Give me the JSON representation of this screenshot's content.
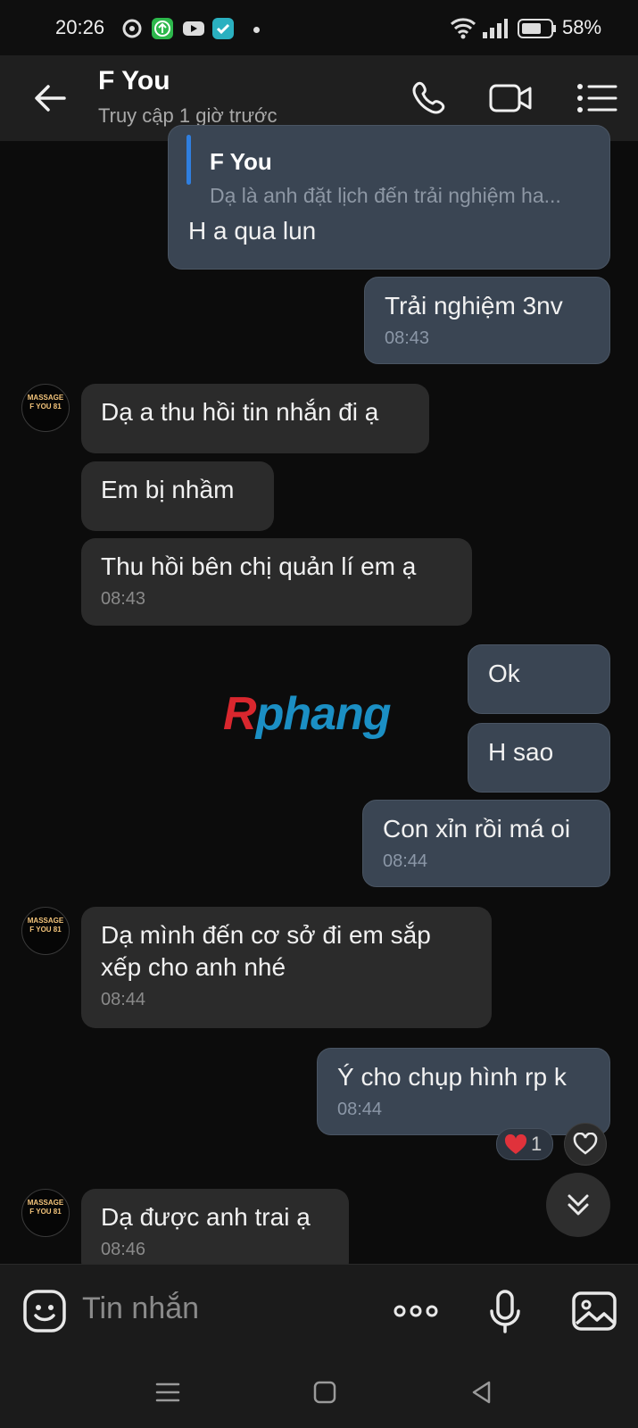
{
  "status_bar": {
    "time": "20:26",
    "battery_percent": "58%",
    "notification_icons": [
      "location-icon",
      "upload-icon",
      "youtube-icon",
      "app-check-icon"
    ]
  },
  "header": {
    "contact_name": "F You",
    "last_seen": "Truy cập 1 giờ trước",
    "icons": [
      "back-arrow-icon",
      "phone-icon",
      "video-call-icon",
      "menu-list-icon"
    ]
  },
  "avatar_text": {
    "line1": "MASSAGE",
    "line2": "F YOU 81"
  },
  "messages": [
    {
      "dir": "out",
      "reply_to_name": "F You",
      "reply_to_text": "Dạ là anh đặt lịch đến trải nghiệm ha...",
      "text": "H a qua lun",
      "time": ""
    },
    {
      "dir": "out",
      "text": "Trải nghiệm 3nv",
      "time": "08:43"
    },
    {
      "dir": "in",
      "text": "Dạ a thu hồi tin nhắn đi ạ",
      "time": ""
    },
    {
      "dir": "in",
      "text": "Em bị nhầm",
      "time": ""
    },
    {
      "dir": "in",
      "text": "Thu hồi bên chị quản lí em ạ",
      "time": "08:43"
    },
    {
      "dir": "out",
      "text": "Ok",
      "time": ""
    },
    {
      "dir": "out",
      "text": "H sao",
      "time": ""
    },
    {
      "dir": "out",
      "text": "Con xỉn rồi má oi",
      "time": "08:44"
    },
    {
      "dir": "in",
      "text": "Dạ mình đến cơ sở đi em sắp xếp cho anh nhé",
      "time": "08:44"
    },
    {
      "dir": "out",
      "text": "Ý cho chụp hình rp k",
      "time": "08:44",
      "reaction_count": "1"
    },
    {
      "dir": "in",
      "text": "Dạ được anh trai ạ",
      "time": "08:46"
    }
  ],
  "watermark": "Rphang",
  "input": {
    "placeholder": "Tin nhắn"
  },
  "colors": {
    "background": "#0c0c0c",
    "incoming_bubble": "#2b2b2b",
    "outgoing_bubble": "#3a4553",
    "reply_accent": "#2f7fe0",
    "reaction_heart": "#e0323b"
  }
}
